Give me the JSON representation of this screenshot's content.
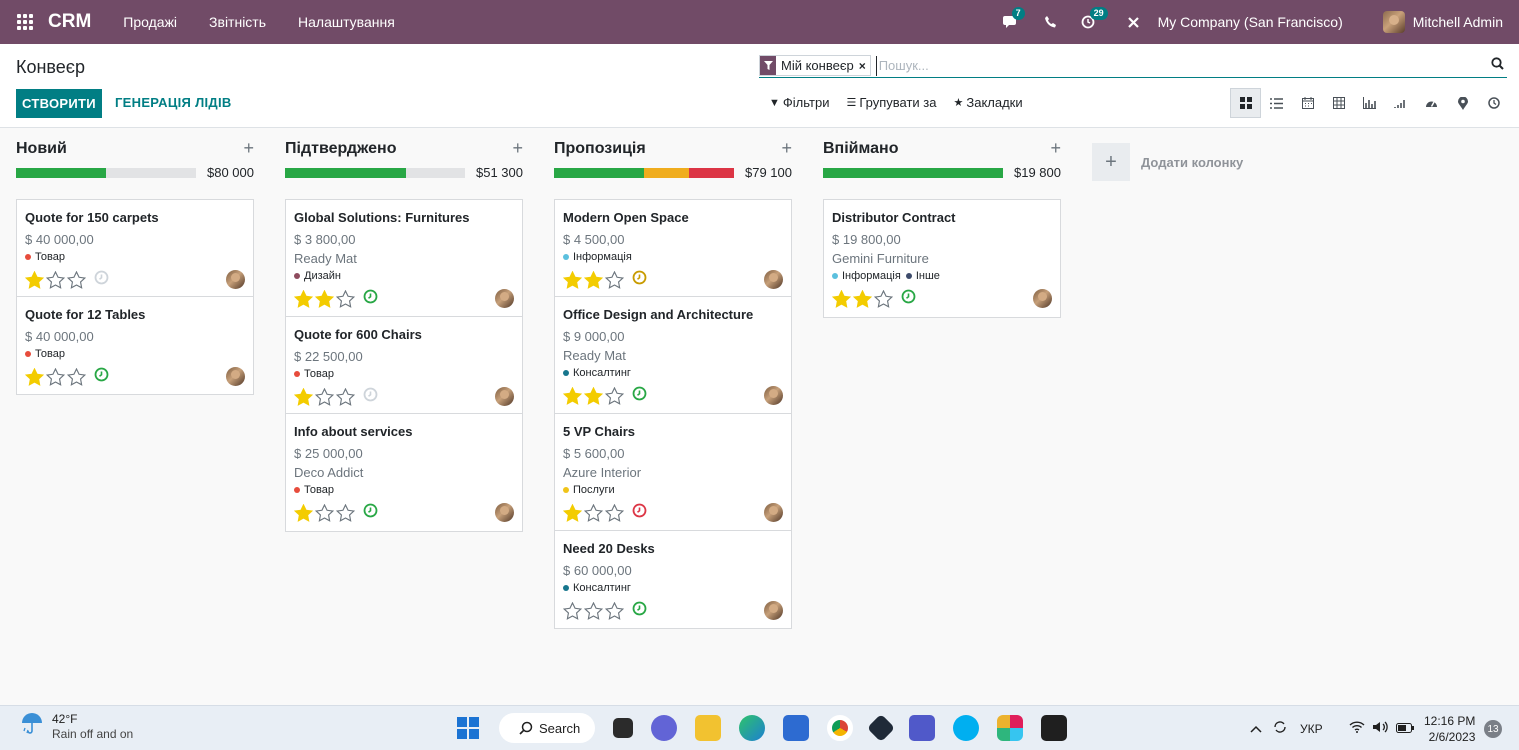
{
  "topbar": {
    "brand": "CRM",
    "menu": [
      "Продажі",
      "Звітність",
      "Налаштування"
    ],
    "messages_count": "7",
    "activities_count": "29",
    "company": "My Company (San Francisco)",
    "user": "Mitchell Admin"
  },
  "control_panel": {
    "title": "Конвеєр",
    "create_label": "СТВОРИТИ",
    "generate_label": "ГЕНЕРАЦІЯ ЛІДІВ",
    "facet": "Мій конвеєр",
    "search_placeholder": "Пошук...",
    "filters": "Фільтри",
    "group_by": "Групувати за",
    "favorites": "Закладки"
  },
  "columns": [
    {
      "name": "Новий",
      "amount": "$80 000",
      "progress": [
        {
          "color": "#28a745",
          "fraction": 0.5
        }
      ],
      "cards": [
        {
          "name": "Quote for 150 carpets",
          "revenue": "$ 40 000,00",
          "customer": "",
          "tags": [
            {
              "label": "Товар",
              "color": "#e74c3c"
            }
          ],
          "stars": 1,
          "activity": "none"
        },
        {
          "name": "Quote for 12 Tables",
          "revenue": "$ 40 000,00",
          "customer": "",
          "tags": [
            {
              "label": "Товар",
              "color": "#e74c3c"
            }
          ],
          "stars": 1,
          "activity": "ok"
        }
      ]
    },
    {
      "name": "Підтверджено",
      "amount": "$51 300",
      "progress": [
        {
          "color": "#28a745",
          "fraction": 0.67
        }
      ],
      "cards": [
        {
          "name": "Global Solutions: Furnitures",
          "revenue": "$ 3 800,00",
          "customer": "Ready Mat",
          "tags": [
            {
              "label": "Дизайн",
              "color": "#8e4b5e"
            }
          ],
          "stars": 2,
          "activity": "ok"
        },
        {
          "name": "Quote for 600 Chairs",
          "revenue": "$ 22 500,00",
          "customer": "",
          "tags": [
            {
              "label": "Товар",
              "color": "#e74c3c"
            }
          ],
          "stars": 1,
          "activity": "none"
        },
        {
          "name": "Info about services",
          "revenue": "$ 25 000,00",
          "customer": "Deco Addict",
          "tags": [
            {
              "label": "Товар",
              "color": "#e74c3c"
            }
          ],
          "stars": 1,
          "activity": "ok"
        }
      ]
    },
    {
      "name": "Пропозиція",
      "amount": "$79 100",
      "progress": [
        {
          "color": "#28a745",
          "fraction": 0.5
        },
        {
          "color": "#f0ad1e",
          "fraction": 0.25
        },
        {
          "color": "#dc3545",
          "fraction": 0.25
        }
      ],
      "cards": [
        {
          "name": "Modern Open Space",
          "revenue": "$ 4 500,00",
          "customer": "",
          "tags": [
            {
              "label": "Інформація",
              "color": "#5bc0de"
            }
          ],
          "stars": 2,
          "activity": "warning"
        },
        {
          "name": "Office Design and Architecture",
          "revenue": "$ 9 000,00",
          "customer": "Ready Mat",
          "tags": [
            {
              "label": "Консалтинг",
              "color": "#17768d"
            }
          ],
          "stars": 2,
          "activity": "ok"
        },
        {
          "name": "5 VP Chairs",
          "revenue": "$ 5 600,00",
          "customer": "Azure Interior",
          "tags": [
            {
              "label": "Послуги",
              "color": "#f0c419"
            }
          ],
          "stars": 1,
          "activity": "overdue"
        },
        {
          "name": "Need 20 Desks",
          "revenue": "$ 60 000,00",
          "customer": "",
          "tags": [
            {
              "label": "Консалтинг",
              "color": "#17768d"
            }
          ],
          "stars": 0,
          "activity": "ok"
        }
      ]
    },
    {
      "name": "Впіймано",
      "amount": "$19 800",
      "progress": [
        {
          "color": "#28a745",
          "fraction": 1.0
        }
      ],
      "cards": [
        {
          "name": "Distributor Contract",
          "revenue": "$ 19 800,00",
          "customer": "Gemini Furniture",
          "tags": [
            {
              "label": "Інформація",
              "color": "#5bc0de"
            },
            {
              "label": "Інше",
              "color": "#3d4b6b"
            }
          ],
          "stars": 2,
          "activity": "ok"
        }
      ]
    }
  ],
  "add_column_label": "Додати колонку",
  "colors": {
    "brand": "#714b67",
    "accent": "#017e84",
    "star": "#f3cc00"
  },
  "taskbar": {
    "temperature": "42°F",
    "weather": "Rain off and on",
    "search": "Search",
    "language": "УКР",
    "time": "12:16 PM",
    "date": "2/6/2023",
    "notifications": "13"
  }
}
